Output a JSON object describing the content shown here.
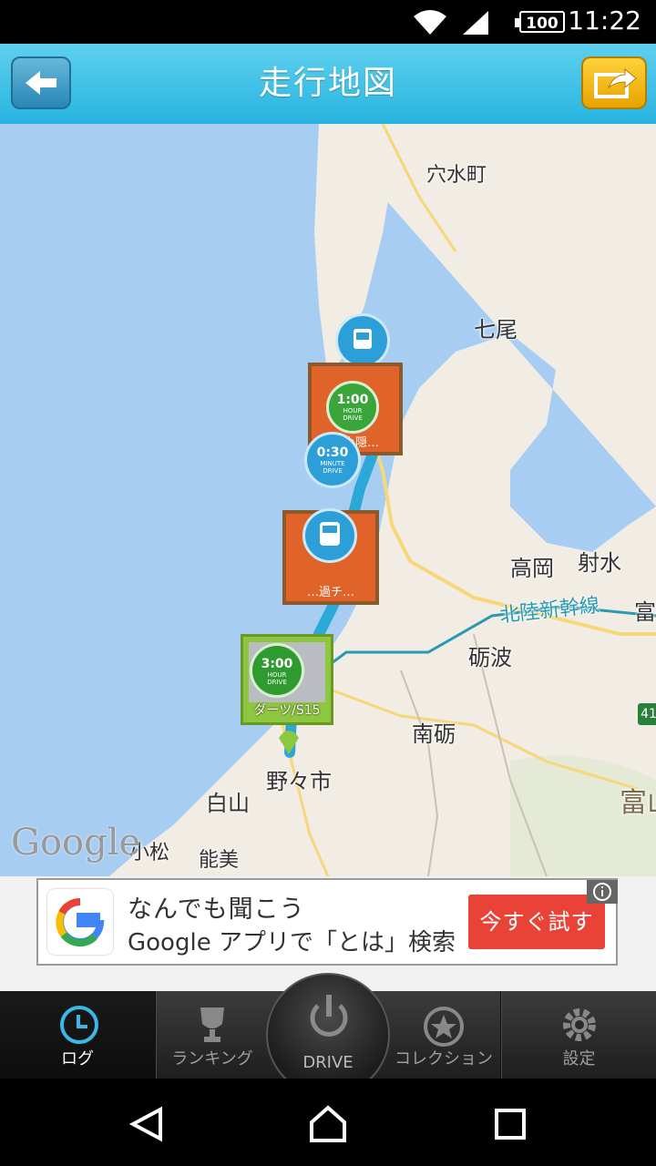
{
  "status_bar": {
    "time": "11:22",
    "battery": "100"
  },
  "header": {
    "title": "走行地図"
  },
  "map": {
    "watermark": "Google",
    "places": [
      "穴水町",
      "七尾",
      "高岡",
      "射水",
      "砺波",
      "南砺",
      "白山",
      "野々市",
      "小松",
      "能美",
      "富山",
      "富"
    ],
    "rail_line": "北陸新幹線",
    "highway_number": "41",
    "markers": {
      "one_hour": {
        "time": "1:00",
        "unit": "HOUR",
        "sub": "DRIVE"
      },
      "half_hour": {
        "time": "0:30",
        "unit": "MINUTE",
        "sub": "DRIVE"
      },
      "three_hour": {
        "time": "3:00",
        "unit": "HOUR",
        "sub": "DRIVE"
      },
      "photo_caption": "ダーツ/S15",
      "sign1_caption": "…小隠…",
      "sign2_caption": "…過チ…"
    }
  },
  "ad": {
    "title": "なんでも聞こう",
    "text": "Google アプリで「とは」検索",
    "cta": "今すぐ試す"
  },
  "tabs": [
    {
      "label": "ログ",
      "icon": "clock-icon"
    },
    {
      "label": "ランキング",
      "icon": "trophy-icon"
    },
    {
      "label": "DRIVE",
      "icon": "power-icon"
    },
    {
      "label": "コレクション",
      "icon": "star-icon"
    },
    {
      "label": "設定",
      "icon": "gear-icon"
    }
  ],
  "colors": {
    "header": "#27b4e0",
    "accent_tab": "#3ab8e8",
    "route": "#2aa8d8",
    "share_button": "#f2b400",
    "ad_cta": "#e84336"
  }
}
